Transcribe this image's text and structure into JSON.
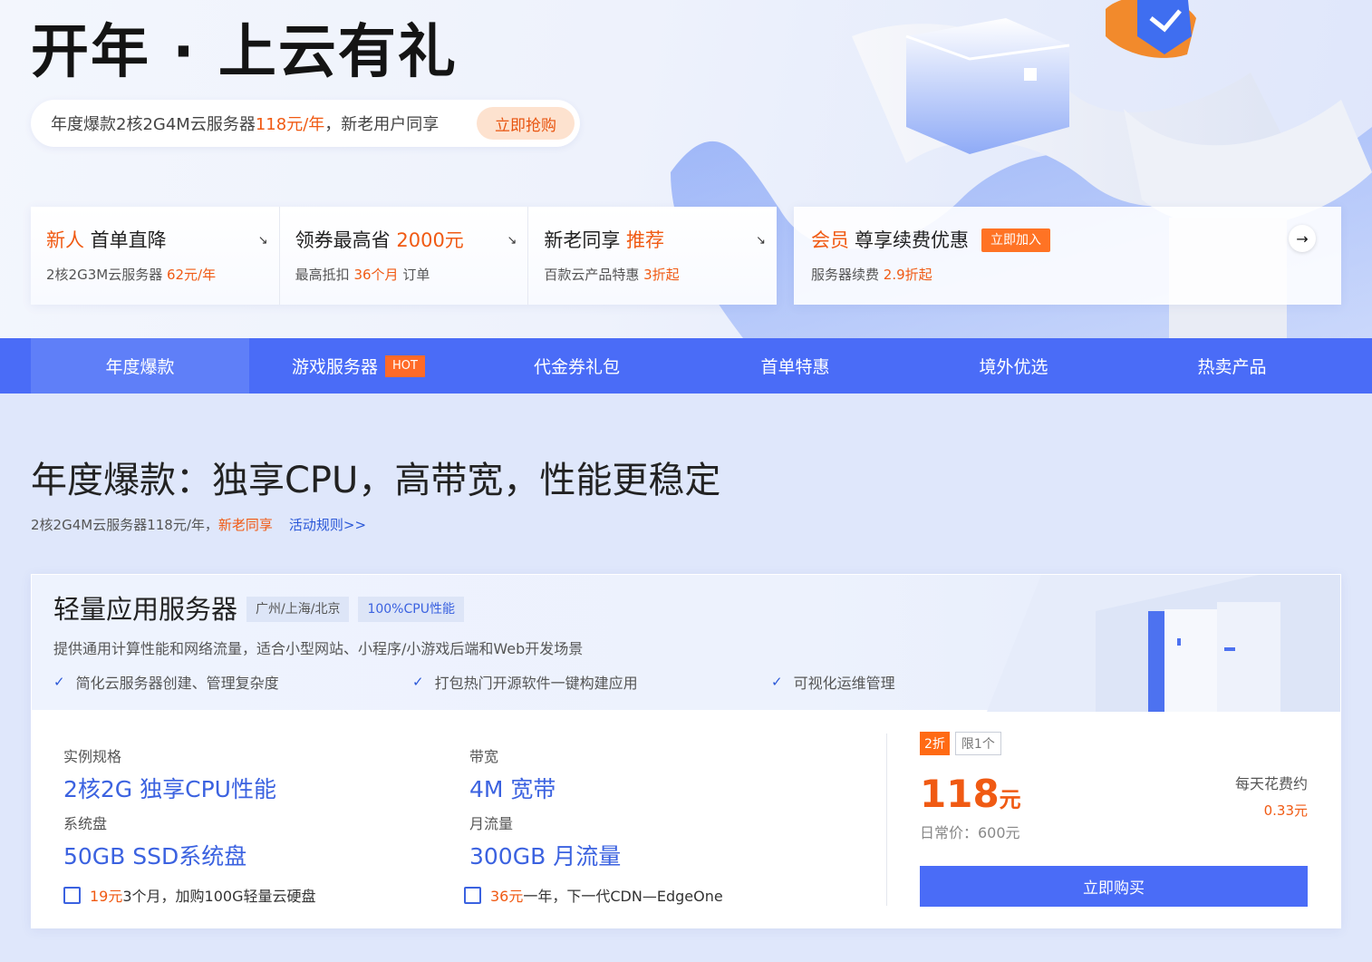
{
  "hero": {
    "title": "开年 · 上云有礼",
    "promo_text": "年度爆款2核2G4M云服务器",
    "promo_price": "118元/年",
    "promo_suffix": "，新老用户同享",
    "grab_button": "立即抢购"
  },
  "cards": [
    {
      "title_hl": "新人",
      "title": " 首单直降",
      "sub": "2核2G3M云服务器 ",
      "sub_hl": "62元/年",
      "arrow": "↘"
    },
    {
      "title": "领券最高省 ",
      "title_hl": "2000元",
      "sub": "最高抵扣 ",
      "sub_hl": "36个月",
      "sub_suffix": " 订单",
      "arrow": "↘"
    },
    {
      "title": "新老同享 ",
      "title_hl": "推荐",
      "sub": "百款云产品特惠 ",
      "sub_hl": "3折起",
      "arrow": "↘"
    }
  ],
  "member": {
    "title_hl": "会员",
    "title": "尊享续费优惠",
    "badge": "立即加入",
    "sub": "服务器续费 ",
    "sub_hl": "2.9折起",
    "arrow": "→"
  },
  "tabs": [
    {
      "label": "年度爆款",
      "active": true
    },
    {
      "label": "游戏服务器",
      "badge": "HOT"
    },
    {
      "label": "代金券礼包"
    },
    {
      "label": "首单特惠"
    },
    {
      "label": "境外优选"
    },
    {
      "label": "热卖产品"
    }
  ],
  "section": {
    "title": "年度爆款：独享CPU，高带宽，性能更稳定",
    "sub": "2核2G4M云服务器118元/年，",
    "sub_hl": "新老同享",
    "rules_link": "活动规则>>"
  },
  "product": {
    "name": "轻量应用服务器",
    "tags": [
      "广州/上海/北京",
      "100%CPU性能"
    ],
    "desc": "提供通用计算性能和网络流量，适合小型网站、小程序/小游戏后端和Web开发场景",
    "features": [
      "简化云服务器创建、管理复杂度",
      "打包热门开源软件一键构建应用",
      "可视化运维管理"
    ],
    "specs": [
      {
        "label": "实例规格",
        "value": "2核2G 独享CPU性能"
      },
      {
        "label": "带宽",
        "value": "4M 宽带"
      },
      {
        "label": "系统盘",
        "value": "50GB SSD系统盘"
      },
      {
        "label": "月流量",
        "value": "300GB 月流量"
      }
    ],
    "addons": [
      {
        "price": "19元",
        "text": "3个月，加购100G轻量云硬盘"
      },
      {
        "price": "36元",
        "text": "一年，下一代CDN—EdgeOne"
      }
    ],
    "discount": "2折",
    "limit": "限1个",
    "price": "118",
    "price_unit": "元",
    "original": "日常价：600元",
    "daily_label": "每天花费约",
    "daily_value": "0.33元",
    "buy_button": "立即购买"
  },
  "colors": {
    "accent": "#4a6cf7",
    "highlight": "#f05a13"
  }
}
